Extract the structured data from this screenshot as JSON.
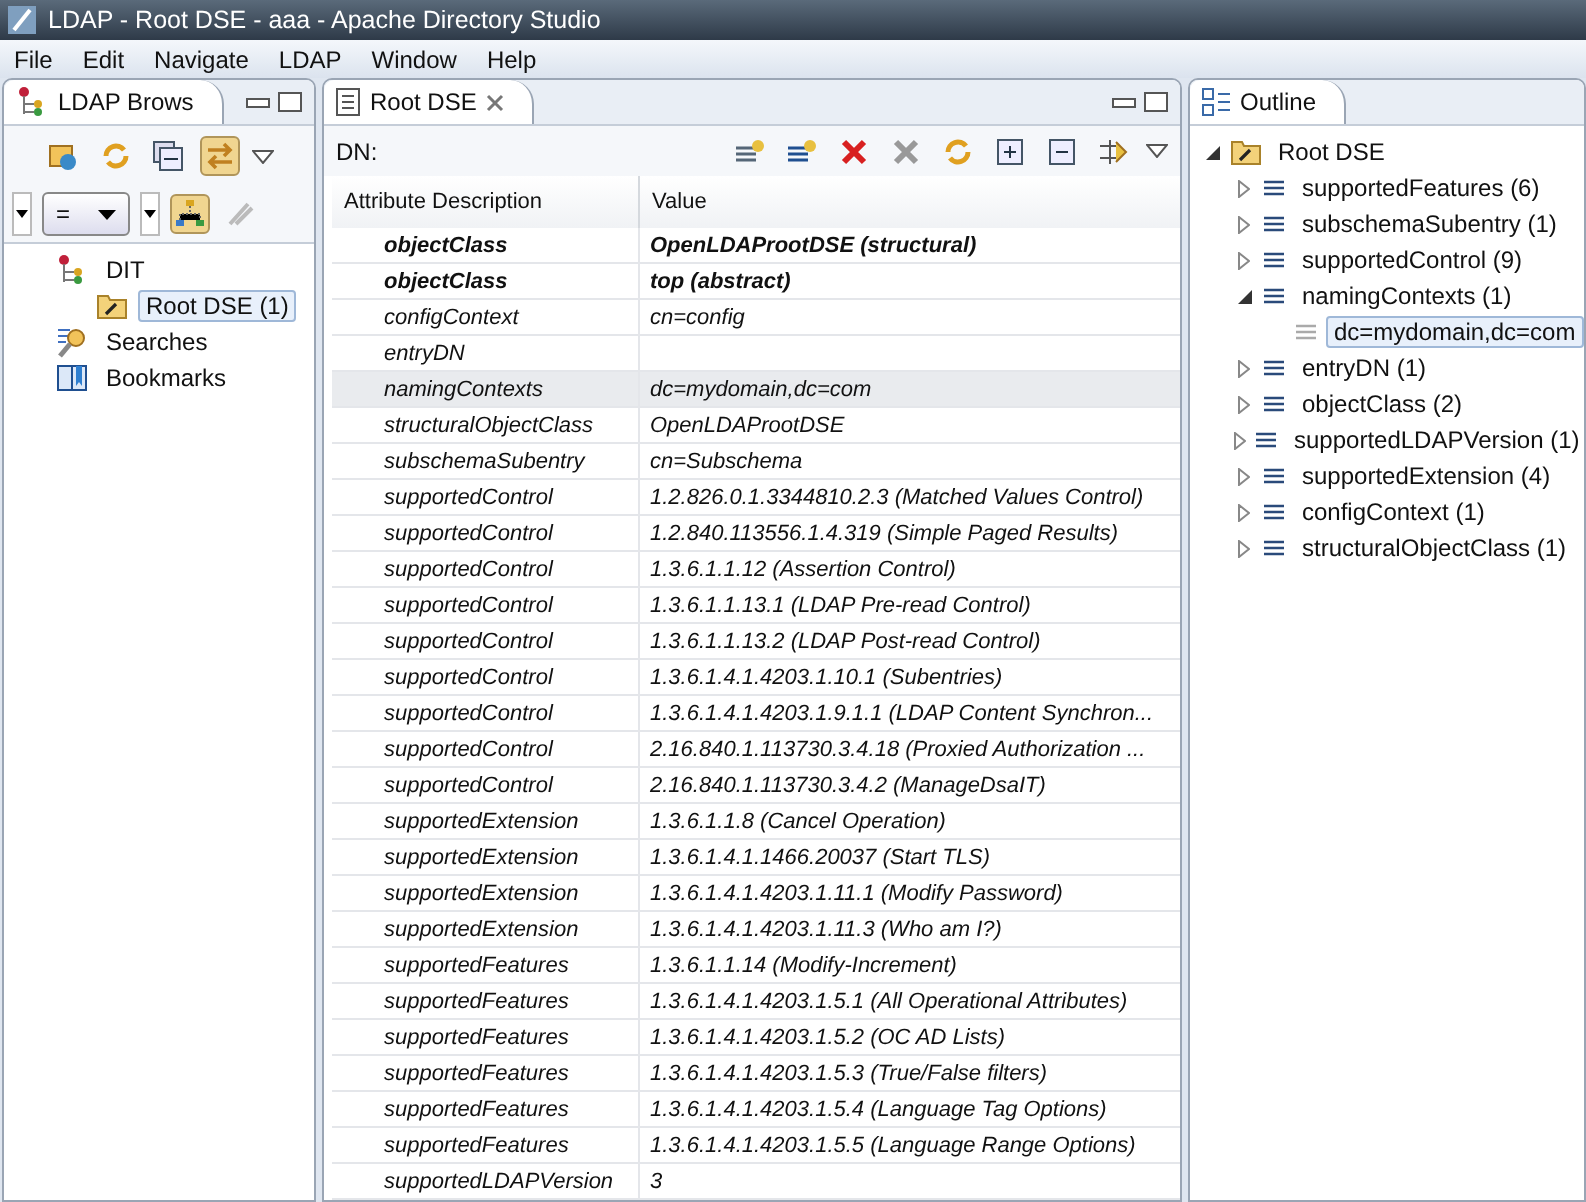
{
  "window": {
    "title": "LDAP - Root DSE - aaa - Apache Directory Studio"
  },
  "menu": [
    "File",
    "Edit",
    "Navigate",
    "LDAP",
    "Window",
    "Help"
  ],
  "browser": {
    "title": "LDAP Brows",
    "filter": {
      "operator": "="
    },
    "tree": [
      {
        "label": "DIT",
        "kind": "dit",
        "selected": false,
        "children": [
          {
            "label": "Root DSE (1)",
            "kind": "entry",
            "selected": true
          }
        ]
      },
      {
        "label": "Searches",
        "kind": "searches",
        "selected": false
      },
      {
        "label": "Bookmarks",
        "kind": "bookmarks",
        "selected": false
      }
    ]
  },
  "editor": {
    "tab": "Root DSE",
    "dn_label": "DN:",
    "columns": [
      "Attribute Description",
      "Value"
    ],
    "rows": [
      {
        "attribute": "objectClass",
        "value": "OpenLDAProotDSE (structural)",
        "kind": "must",
        "selected": false
      },
      {
        "attribute": "objectClass",
        "value": "top (abstract)",
        "kind": "must",
        "selected": false
      },
      {
        "attribute": "configContext",
        "value": "cn=config",
        "kind": "may",
        "selected": false
      },
      {
        "attribute": "entryDN",
        "value": "",
        "kind": "may",
        "selected": false
      },
      {
        "attribute": "namingContexts",
        "value": "dc=mydomain,dc=com",
        "kind": "may",
        "selected": true
      },
      {
        "attribute": "structuralObjectClass",
        "value": "OpenLDAProotDSE",
        "kind": "may",
        "selected": false
      },
      {
        "attribute": "subschemaSubentry",
        "value": "cn=Subschema",
        "kind": "may",
        "selected": false
      },
      {
        "attribute": "supportedControl",
        "value": "1.2.826.0.1.3344810.2.3 (Matched Values Control)",
        "kind": "may",
        "selected": false
      },
      {
        "attribute": "supportedControl",
        "value": "1.2.840.113556.1.4.319 (Simple Paged Results)",
        "kind": "may",
        "selected": false
      },
      {
        "attribute": "supportedControl",
        "value": "1.3.6.1.1.12 (Assertion Control)",
        "kind": "may",
        "selected": false
      },
      {
        "attribute": "supportedControl",
        "value": "1.3.6.1.1.13.1 (LDAP Pre-read Control)",
        "kind": "may",
        "selected": false
      },
      {
        "attribute": "supportedControl",
        "value": "1.3.6.1.1.13.2 (LDAP Post-read Control)",
        "kind": "may",
        "selected": false
      },
      {
        "attribute": "supportedControl",
        "value": "1.3.6.1.4.1.4203.1.10.1 (Subentries)",
        "kind": "may",
        "selected": false
      },
      {
        "attribute": "supportedControl",
        "value": "1.3.6.1.4.1.4203.1.9.1.1 (LDAP Content Synchron...",
        "kind": "may",
        "selected": false
      },
      {
        "attribute": "supportedControl",
        "value": "2.16.840.1.113730.3.4.18 (Proxied Authorization ...",
        "kind": "may",
        "selected": false
      },
      {
        "attribute": "supportedControl",
        "value": "2.16.840.1.113730.3.4.2 (ManageDsaIT)",
        "kind": "may",
        "selected": false
      },
      {
        "attribute": "supportedExtension",
        "value": "1.3.6.1.1.8 (Cancel Operation)",
        "kind": "may",
        "selected": false
      },
      {
        "attribute": "supportedExtension",
        "value": "1.3.6.1.4.1.1466.20037 (Start TLS)",
        "kind": "may",
        "selected": false
      },
      {
        "attribute": "supportedExtension",
        "value": "1.3.6.1.4.1.4203.1.11.1 (Modify Password)",
        "kind": "may",
        "selected": false
      },
      {
        "attribute": "supportedExtension",
        "value": "1.3.6.1.4.1.4203.1.11.3 (Who am I?)",
        "kind": "may",
        "selected": false
      },
      {
        "attribute": "supportedFeatures",
        "value": "1.3.6.1.1.14 (Modify-Increment)",
        "kind": "may",
        "selected": false
      },
      {
        "attribute": "supportedFeatures",
        "value": "1.3.6.1.4.1.4203.1.5.1 (All Operational Attributes)",
        "kind": "may",
        "selected": false
      },
      {
        "attribute": "supportedFeatures",
        "value": "1.3.6.1.4.1.4203.1.5.2 (OC AD Lists)",
        "kind": "may",
        "selected": false
      },
      {
        "attribute": "supportedFeatures",
        "value": "1.3.6.1.4.1.4203.1.5.3 (True/False filters)",
        "kind": "may",
        "selected": false
      },
      {
        "attribute": "supportedFeatures",
        "value": "1.3.6.1.4.1.4203.1.5.4 (Language Tag Options)",
        "kind": "may",
        "selected": false
      },
      {
        "attribute": "supportedFeatures",
        "value": "1.3.6.1.4.1.4203.1.5.5 (Language Range Options)",
        "kind": "may",
        "selected": false
      },
      {
        "attribute": "supportedLDAPVersion",
        "value": "3",
        "kind": "may",
        "selected": false
      }
    ]
  },
  "outline": {
    "title": "Outline",
    "tree": [
      {
        "label": "Root DSE",
        "kind": "entry",
        "expanded": true,
        "selected": false,
        "children": [
          {
            "label": "supportedFeatures (6)",
            "kind": "attribute",
            "expanded": false,
            "selected": false
          },
          {
            "label": "subschemaSubentry (1)",
            "kind": "attribute",
            "expanded": false,
            "selected": false
          },
          {
            "label": "supportedControl (9)",
            "kind": "attribute",
            "expanded": false,
            "selected": false
          },
          {
            "label": "namingContexts (1)",
            "kind": "attribute",
            "expanded": true,
            "selected": false,
            "children": [
              {
                "label": "dc=mydomain,dc=com",
                "kind": "value",
                "selected": true
              }
            ]
          },
          {
            "label": "entryDN (1)",
            "kind": "attribute",
            "expanded": false,
            "selected": false
          },
          {
            "label": "objectClass (2)",
            "kind": "attribute",
            "expanded": false,
            "selected": false
          },
          {
            "label": "supportedLDAPVersion (1)",
            "kind": "attribute",
            "expanded": false,
            "selected": false
          },
          {
            "label": "supportedExtension (4)",
            "kind": "attribute",
            "expanded": false,
            "selected": false
          },
          {
            "label": "configContext (1)",
            "kind": "attribute",
            "expanded": false,
            "selected": false
          },
          {
            "label": "structuralObjectClass (1)",
            "kind": "attribute",
            "expanded": false,
            "selected": false
          }
        ]
      }
    ]
  }
}
